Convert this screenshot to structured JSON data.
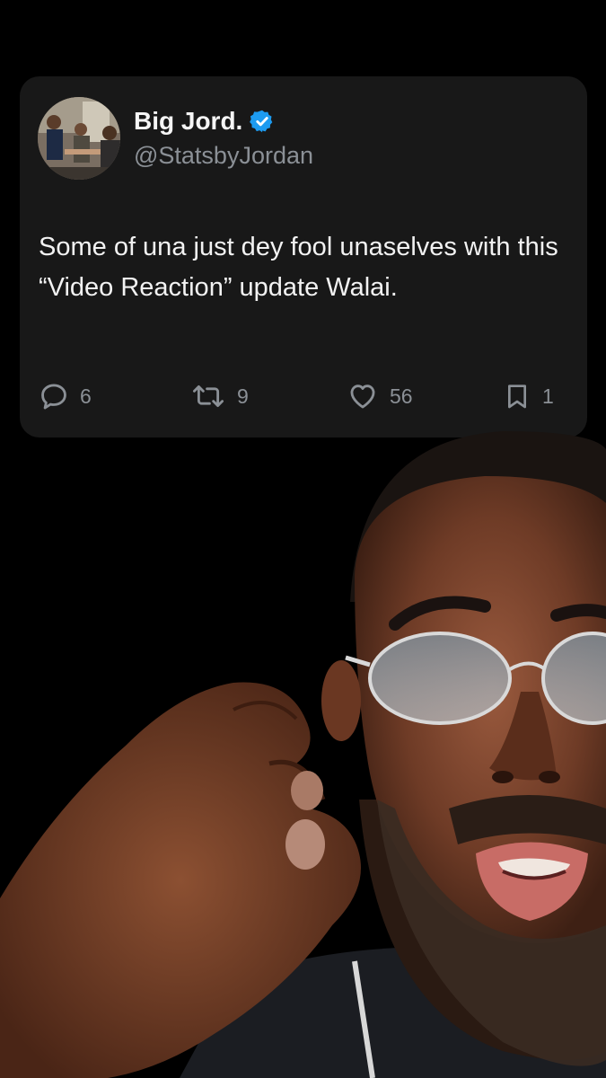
{
  "tweet": {
    "display_name": "Big Jord.",
    "handle": "@StatsbyJordan",
    "text": "Some of una just dey fool unaselves with this “Video Reaction” update Walai.",
    "verified": true,
    "avatar_icon": "profile-photo",
    "metrics": {
      "replies": "6",
      "reposts": "9",
      "likes": "56",
      "bookmarks": "1"
    }
  },
  "colors": {
    "background": "#000000",
    "card": "#181818",
    "verified_badge": "#1d9bf0",
    "muted_text": "#8b9096"
  },
  "icons": {
    "reply": "reply-icon",
    "repost": "repost-icon",
    "like": "heart-icon",
    "bookmark": "bookmark-icon"
  }
}
